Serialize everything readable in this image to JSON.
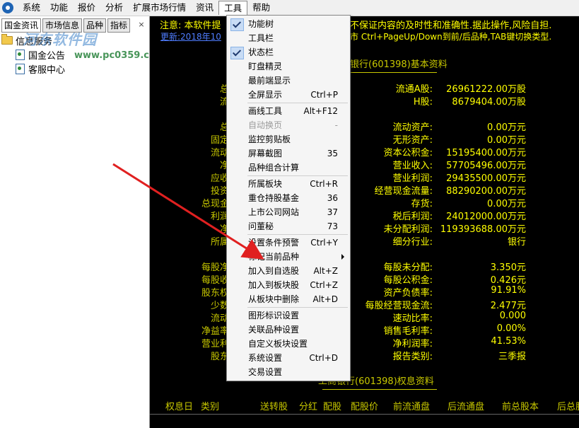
{
  "menubar": {
    "items": [
      "系统",
      "功能",
      "报价",
      "分析",
      "扩展市场行情",
      "资讯",
      "工具",
      "帮助"
    ],
    "active_index": 6
  },
  "left_panel": {
    "tabs": [
      "国金资讯",
      "市场信息",
      "品种",
      "指标"
    ],
    "close_glyph": "×",
    "tree": {
      "root_label": "信息服务",
      "children": [
        "国金公告",
        "客服中心"
      ]
    }
  },
  "watermark": {
    "text": "河东软件园",
    "url": "www.pc0359.cn"
  },
  "main": {
    "notice_prefix": "注意: 本软件提",
    "notice_suffix": "不保证内容的及时性和准确性.据此操作,风险自担.",
    "update_link": "更新:2018年10",
    "update_hint": "市 Ctrl+PageUp/Down到前/后品种,TAB键切换类型.",
    "basic_title": "银行(601398)基本资料",
    "rights_title": "工商银行(601398)权息资料",
    "left_labels": [
      "总",
      "流",
      "总",
      "固定",
      "流动",
      "净",
      "应收",
      "投资",
      "总现金",
      "利润",
      "净",
      "所属",
      "每股净",
      "每股收",
      "股东权",
      "少数",
      "流动",
      "净益率",
      "营业利",
      "股东"
    ],
    "rows": [
      {
        "label": "流通A股:",
        "value": "26961222.00万股"
      },
      {
        "label": "H股:",
        "value": "8679404.00万股"
      },
      {
        "label": "流动资产:",
        "value": "0.00万元"
      },
      {
        "label": "无形资产:",
        "value": "0.00万元"
      },
      {
        "label": "资本公积金:",
        "value": "15195400.00万元"
      },
      {
        "label": "营业收入:",
        "value": "57705496.00万元"
      },
      {
        "label": "营业利润:",
        "value": "29435500.00万元"
      },
      {
        "label": "经营现金流量:",
        "value": "88290200.00万元"
      },
      {
        "label": "存货:",
        "value": "0.00万元"
      },
      {
        "label": "税后利润:",
        "value": "24012000.00万元"
      },
      {
        "label": "未分配利润:",
        "value": "119393688.00万元"
      },
      {
        "label": "细分行业:",
        "value": "银行"
      },
      {
        "label": "每股未分配:",
        "value": "3.350元"
      },
      {
        "label": "每股公积金:",
        "value": "0.426元"
      },
      {
        "label": "资产负债率:",
        "value": "91.91%"
      },
      {
        "label": "每股经营现金流:",
        "value": "2.477元"
      },
      {
        "label": "速动比率:",
        "value": "0.000"
      },
      {
        "label": "销售毛利率:",
        "value": "0.00%"
      },
      {
        "label": "净利润率:",
        "value": "41.53%"
      },
      {
        "label": "报告类别:",
        "value": "三季报"
      }
    ],
    "columns": [
      "权息日",
      "类别",
      "送转股",
      "分红",
      "配股",
      "配股价",
      "前流通盘",
      "后流通盘",
      "前总股本",
      "后总股"
    ]
  },
  "tools_menu": {
    "items": [
      {
        "label": "功能树",
        "shortcut": "",
        "checked": true
      },
      {
        "label": "工具栏",
        "shortcut": "",
        "checked": false
      },
      {
        "label": "状态栏",
        "shortcut": "",
        "checked": true
      },
      {
        "label": "盯盘精灵",
        "shortcut": ""
      },
      {
        "label": "最前端显示",
        "shortcut": ""
      },
      {
        "label": "全屏显示",
        "shortcut": "Ctrl+P"
      },
      {
        "label": "画线工具",
        "shortcut": "Alt+F12"
      },
      {
        "label": "自动换页",
        "shortcut": "-",
        "disabled": true
      },
      {
        "label": "监控剪贴板",
        "shortcut": ""
      },
      {
        "label": "屏幕截图",
        "shortcut": "35"
      },
      {
        "label": "品种组合计算",
        "shortcut": ""
      },
      {
        "label": "所属板块",
        "shortcut": "Ctrl+R"
      },
      {
        "label": "重仓持股基金",
        "shortcut": "36"
      },
      {
        "label": "上市公司网站",
        "shortcut": "37"
      },
      {
        "label": "问董秘",
        "shortcut": "73"
      },
      {
        "label": "设置条件预警",
        "shortcut": "Ctrl+Y"
      },
      {
        "label": "标记当前品种",
        "shortcut": "",
        "submenu": true
      },
      {
        "label": "加入到自选股",
        "shortcut": "Alt+Z"
      },
      {
        "label": "加入到板块股",
        "shortcut": "Ctrl+Z"
      },
      {
        "label": "从板块中删除",
        "shortcut": "Alt+D"
      },
      {
        "label": "图形标识设置",
        "shortcut": ""
      },
      {
        "label": "关联品种设置",
        "shortcut": ""
      },
      {
        "label": "自定义板块设置",
        "shortcut": ""
      },
      {
        "label": "系统设置",
        "shortcut": "Ctrl+D"
      },
      {
        "label": "交易设置",
        "shortcut": ""
      }
    ]
  },
  "colors": {
    "panel_bg": "#000000",
    "text_yellow": "#ffff00",
    "label_olive": "#c8c800",
    "link_blue": "#4f7dff",
    "annotation_red": "#e02020"
  }
}
